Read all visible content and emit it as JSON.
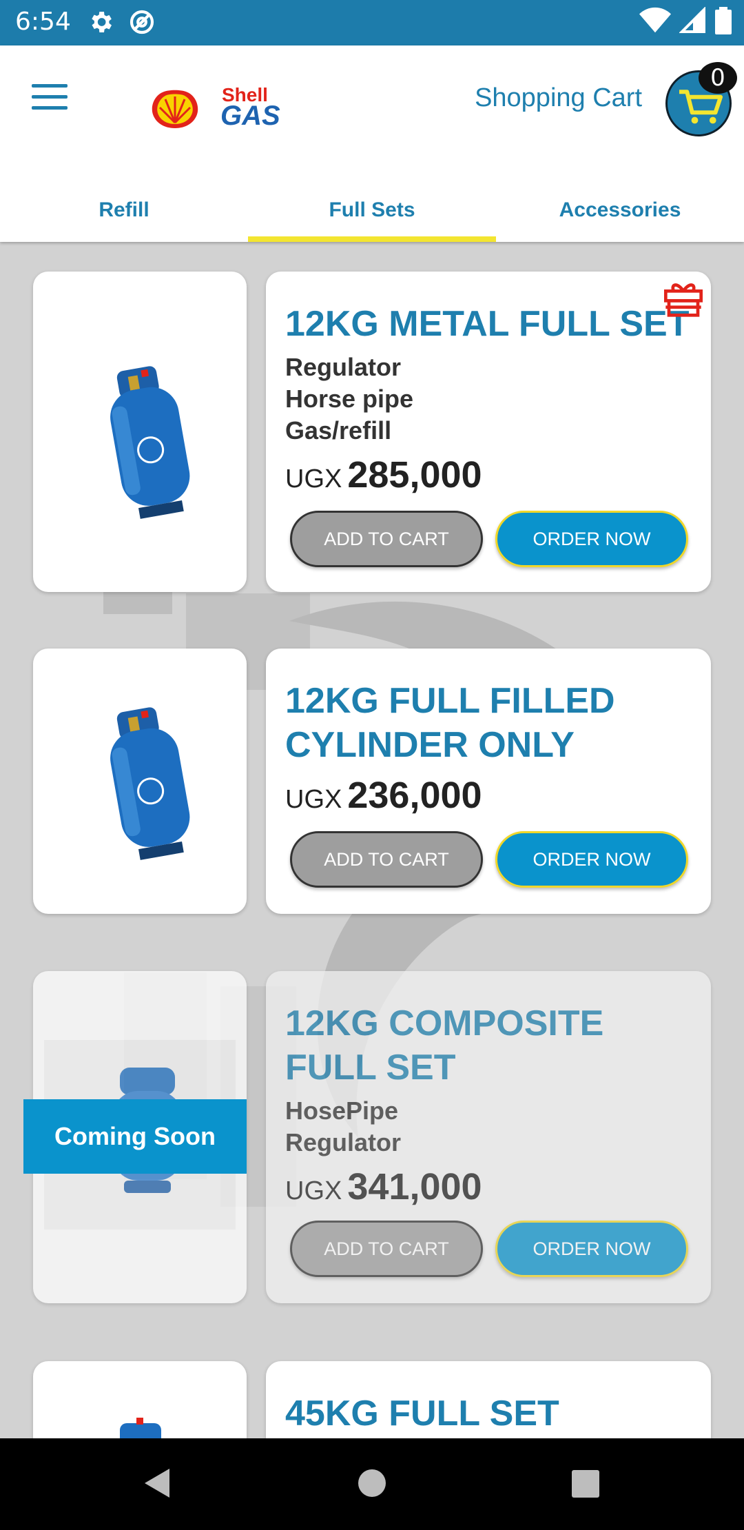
{
  "status_bar": {
    "time": "6:54"
  },
  "header": {
    "brand_top": "Shell",
    "brand_bottom": "GAS",
    "cart_label": "Shopping Cart",
    "cart_count": "0"
  },
  "tabs": [
    {
      "label": "Refill",
      "active": false
    },
    {
      "label": "Full Sets",
      "active": true
    },
    {
      "label": "Accessories",
      "active": false
    }
  ],
  "products": [
    {
      "title": "12KG METAL FULL SET",
      "desc": [
        "Regulator",
        "Horse pipe",
        "Gas/refill"
      ],
      "currency": "UGX",
      "price": "285,000",
      "add_label": "ADD TO CART",
      "order_label": "ORDER NOW"
    },
    {
      "title_lines": [
        "12KG FULL FILLED",
        "CYLINDER ONLY"
      ],
      "currency": "UGX",
      "price": "236,000",
      "add_label": "ADD TO CART",
      "order_label": "ORDER NOW"
    },
    {
      "title_lines": [
        "12KG COMPOSITE",
        "FULL SET"
      ],
      "desc": [
        "HosePipe",
        "Regulator"
      ],
      "currency": "UGX",
      "price": "341,000",
      "add_label": "ADD TO CART",
      "order_label": "ORDER NOW",
      "badge": "Coming Soon"
    },
    {
      "title": "45KG FULL SET"
    }
  ],
  "colors": {
    "primary": "#1e7fae",
    "accent_yellow": "#f3e530",
    "button_blue": "#0a93cc",
    "status_bar": "#1d7cab"
  }
}
